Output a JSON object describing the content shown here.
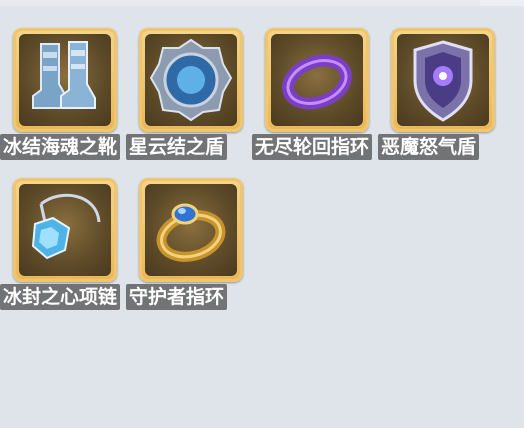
{
  "items": [
    {
      "name": "冰结海魂之靴",
      "icon": "ice-boots-icon"
    },
    {
      "name": "星云结之盾",
      "icon": "round-shield-icon"
    },
    {
      "name": "无尽轮回指环",
      "icon": "purple-ring-icon"
    },
    {
      "name": "恶魔怒气盾",
      "icon": "demon-shield-icon"
    },
    {
      "name": "冰封之心项链",
      "icon": "ice-necklace-icon"
    },
    {
      "name": "守护者指环",
      "icon": "gold-ring-icon"
    }
  ]
}
